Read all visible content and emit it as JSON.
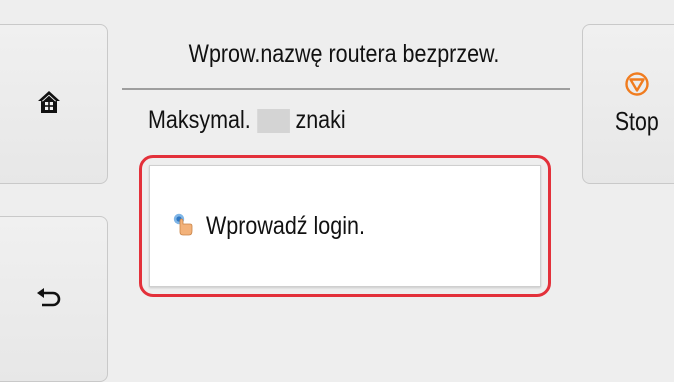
{
  "screen": {
    "title": "Wprow.nazwę routera bezprzew.",
    "subtitle_prefix": "Maksymal.",
    "subtitle_suffix": "znaki",
    "input_prompt": "Wprowadź login."
  },
  "buttons": {
    "home_icon": "home-icon",
    "back_icon": "back-arrow-icon",
    "stop_icon": "stop-icon",
    "stop_label": "Stop"
  },
  "colors": {
    "highlight": "#e3303a",
    "stop_icon": "#f07c1f",
    "background": "#eeeeee",
    "card": "#ffffff"
  }
}
